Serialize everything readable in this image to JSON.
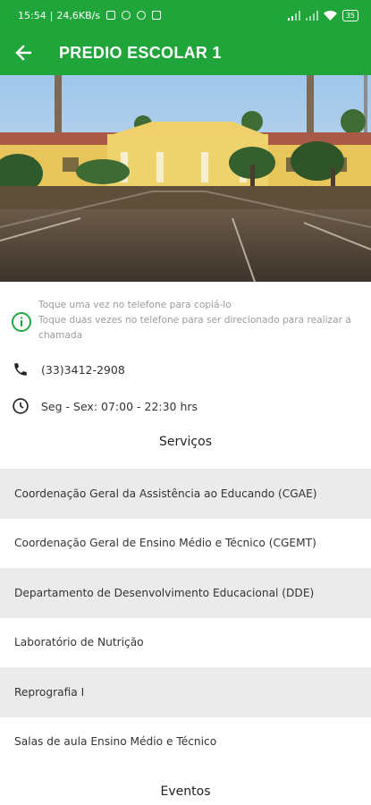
{
  "status_bar": {
    "time": "15:54",
    "speed": "24,6KB/s",
    "battery": "35"
  },
  "app_bar": {
    "title": "PREDIO ESCOLAR 1",
    "color": "#1fa53a"
  },
  "info": {
    "hint_line1": "Toque uma vez no telefone para copiá-lo",
    "hint_line2": "Toque duas vezes no telefone para ser direcionado para realizar a chamada",
    "phone": "(33)3412-2908",
    "hours": "Seg - Sex: 07:00 - 22:30 hrs"
  },
  "services": {
    "title": "Serviços",
    "items": [
      "Coordenação Geral da Assistência ao Educando (CGAE)",
      "Coordenação Geral de Ensino Médio e Técnico (CGEMT)",
      "Departamento de Desenvolvimento Educacional (DDE)",
      "Laboratório de Nutrição",
      "Reprografia I",
      "Salas de aula Ensino Médio e Técnico"
    ]
  },
  "events": {
    "title": "Eventos"
  }
}
